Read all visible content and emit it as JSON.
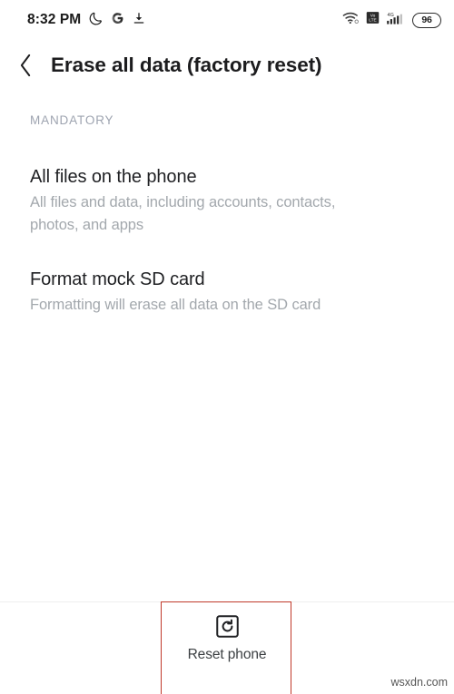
{
  "status_bar": {
    "clock": "8:32 PM",
    "battery_level": "96",
    "network_type": "4G",
    "icons": [
      "moon-icon",
      "google-icon",
      "download-icon",
      "wifi-icon",
      "volte-icon",
      "signal-bars-icon",
      "battery-icon"
    ]
  },
  "app_bar": {
    "back_icon": "chevron-left-icon",
    "title": "Erase all data (factory reset)"
  },
  "section": {
    "label": "MANDATORY"
  },
  "list": {
    "items": [
      {
        "title": "All files on the phone",
        "subtitle": "All files and data, including accounts, contacts, photos, and apps"
      },
      {
        "title": "Format mock SD card",
        "subtitle": "Formatting will erase all data on the SD card"
      }
    ]
  },
  "bottom_bar": {
    "reset_icon": "reset-phone-icon",
    "reset_label": "Reset phone"
  },
  "annotation": {
    "highlight_color": "#c0392b"
  },
  "watermark": {
    "text": "wsxdn.com"
  },
  "colors": {
    "background": "#ffffff",
    "title_text": "#1c1c1e",
    "primary_text": "#202124",
    "secondary_text": "#a3a8ad",
    "section_label": "#9ea4b0",
    "divider": "#eeeeee"
  }
}
